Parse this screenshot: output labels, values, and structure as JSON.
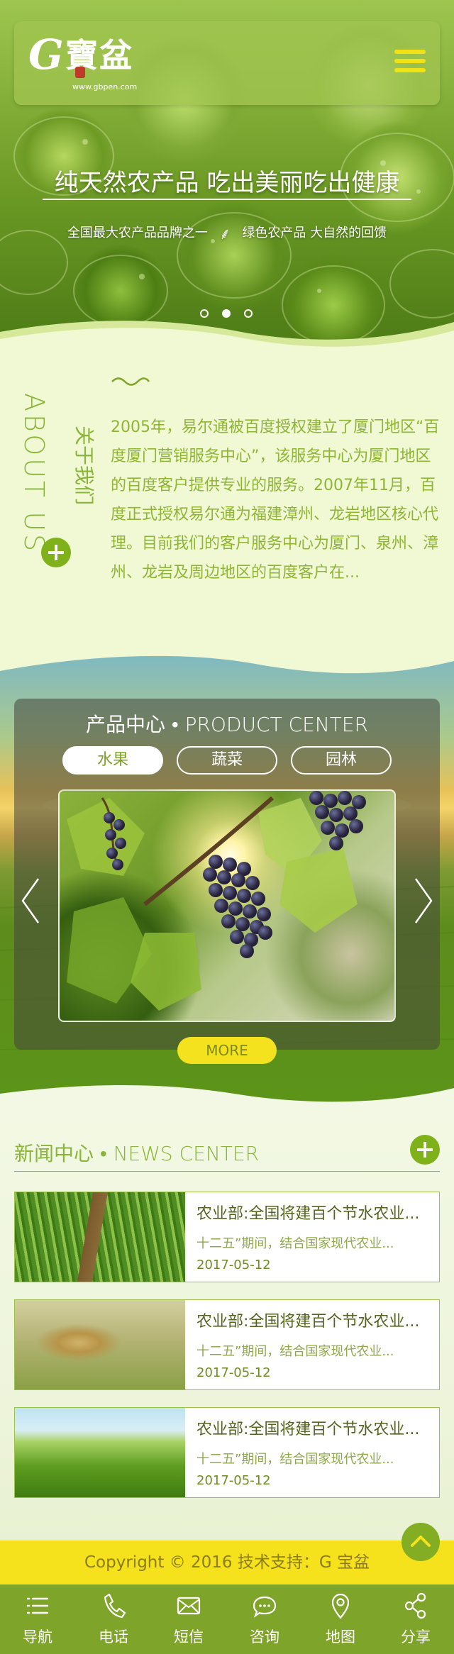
{
  "header": {
    "logo_letter": "G",
    "logo_text": "寶盆",
    "logo_url": "www.gbpen.com",
    "menu_icon": "menu-icon"
  },
  "hero": {
    "title": "纯天然农产品 吃出美丽吃出健康",
    "sub_left": "全国最大农产品品牌之一",
    "sub_right": "绿色农产品 大自然的回馈",
    "slides": 3,
    "active_slide": 2
  },
  "about": {
    "title_en": "ABOUT US",
    "title_cn": "关于我们",
    "text": "2005年，易尔通被百度授权建立了厦门地区“百度厦门营销服务中心”，该服务中心为厦门地区的百度客户提供专业的服务。2007年11月，百度正式授权易尔通为福建漳州、龙岩地区核心代理。目前我们的客户服务中心为厦门、泉州、漳州、龙岩及周边地区的百度客户在..."
  },
  "product": {
    "title": "产品中心 • PRODUCT CENTER",
    "tabs": [
      {
        "label": "水果"
      },
      {
        "label": "蔬菜"
      },
      {
        "label": "园林"
      }
    ],
    "active_tab": 0,
    "more_label": "MORE"
  },
  "news": {
    "title": "新闻中心 • NEWS CENTER",
    "items": [
      {
        "headline": "农业部:全国将建百个节水农业...",
        "desc": "十二五”期间，结合国家现代农业...",
        "date": "2017-05-12"
      },
      {
        "headline": "农业部:全国将建百个节水农业...",
        "desc": "十二五”期间，结合国家现代农业...",
        "date": "2017-05-12"
      },
      {
        "headline": "农业部:全国将建百个节水农业...",
        "desc": "十二五”期间，结合国家现代农业...",
        "date": "2017-05-12"
      }
    ]
  },
  "footer": {
    "copyright": "Copyright © 2016  技术支持：G 宝盆"
  },
  "bottom_nav": [
    {
      "label": "导航",
      "icon": "menu-lines-icon"
    },
    {
      "label": "电话",
      "icon": "phone-icon"
    },
    {
      "label": "短信",
      "icon": "envelope-icon"
    },
    {
      "label": "咨询",
      "icon": "chat-icon"
    },
    {
      "label": "地图",
      "icon": "map-pin-icon"
    },
    {
      "label": "分享",
      "icon": "share-icon"
    }
  ],
  "colors": {
    "accent_green": "#7fb21a",
    "accent_yellow": "#f5e11c",
    "text_green": "#8ab43a",
    "nav_green": "#7fa42a"
  }
}
